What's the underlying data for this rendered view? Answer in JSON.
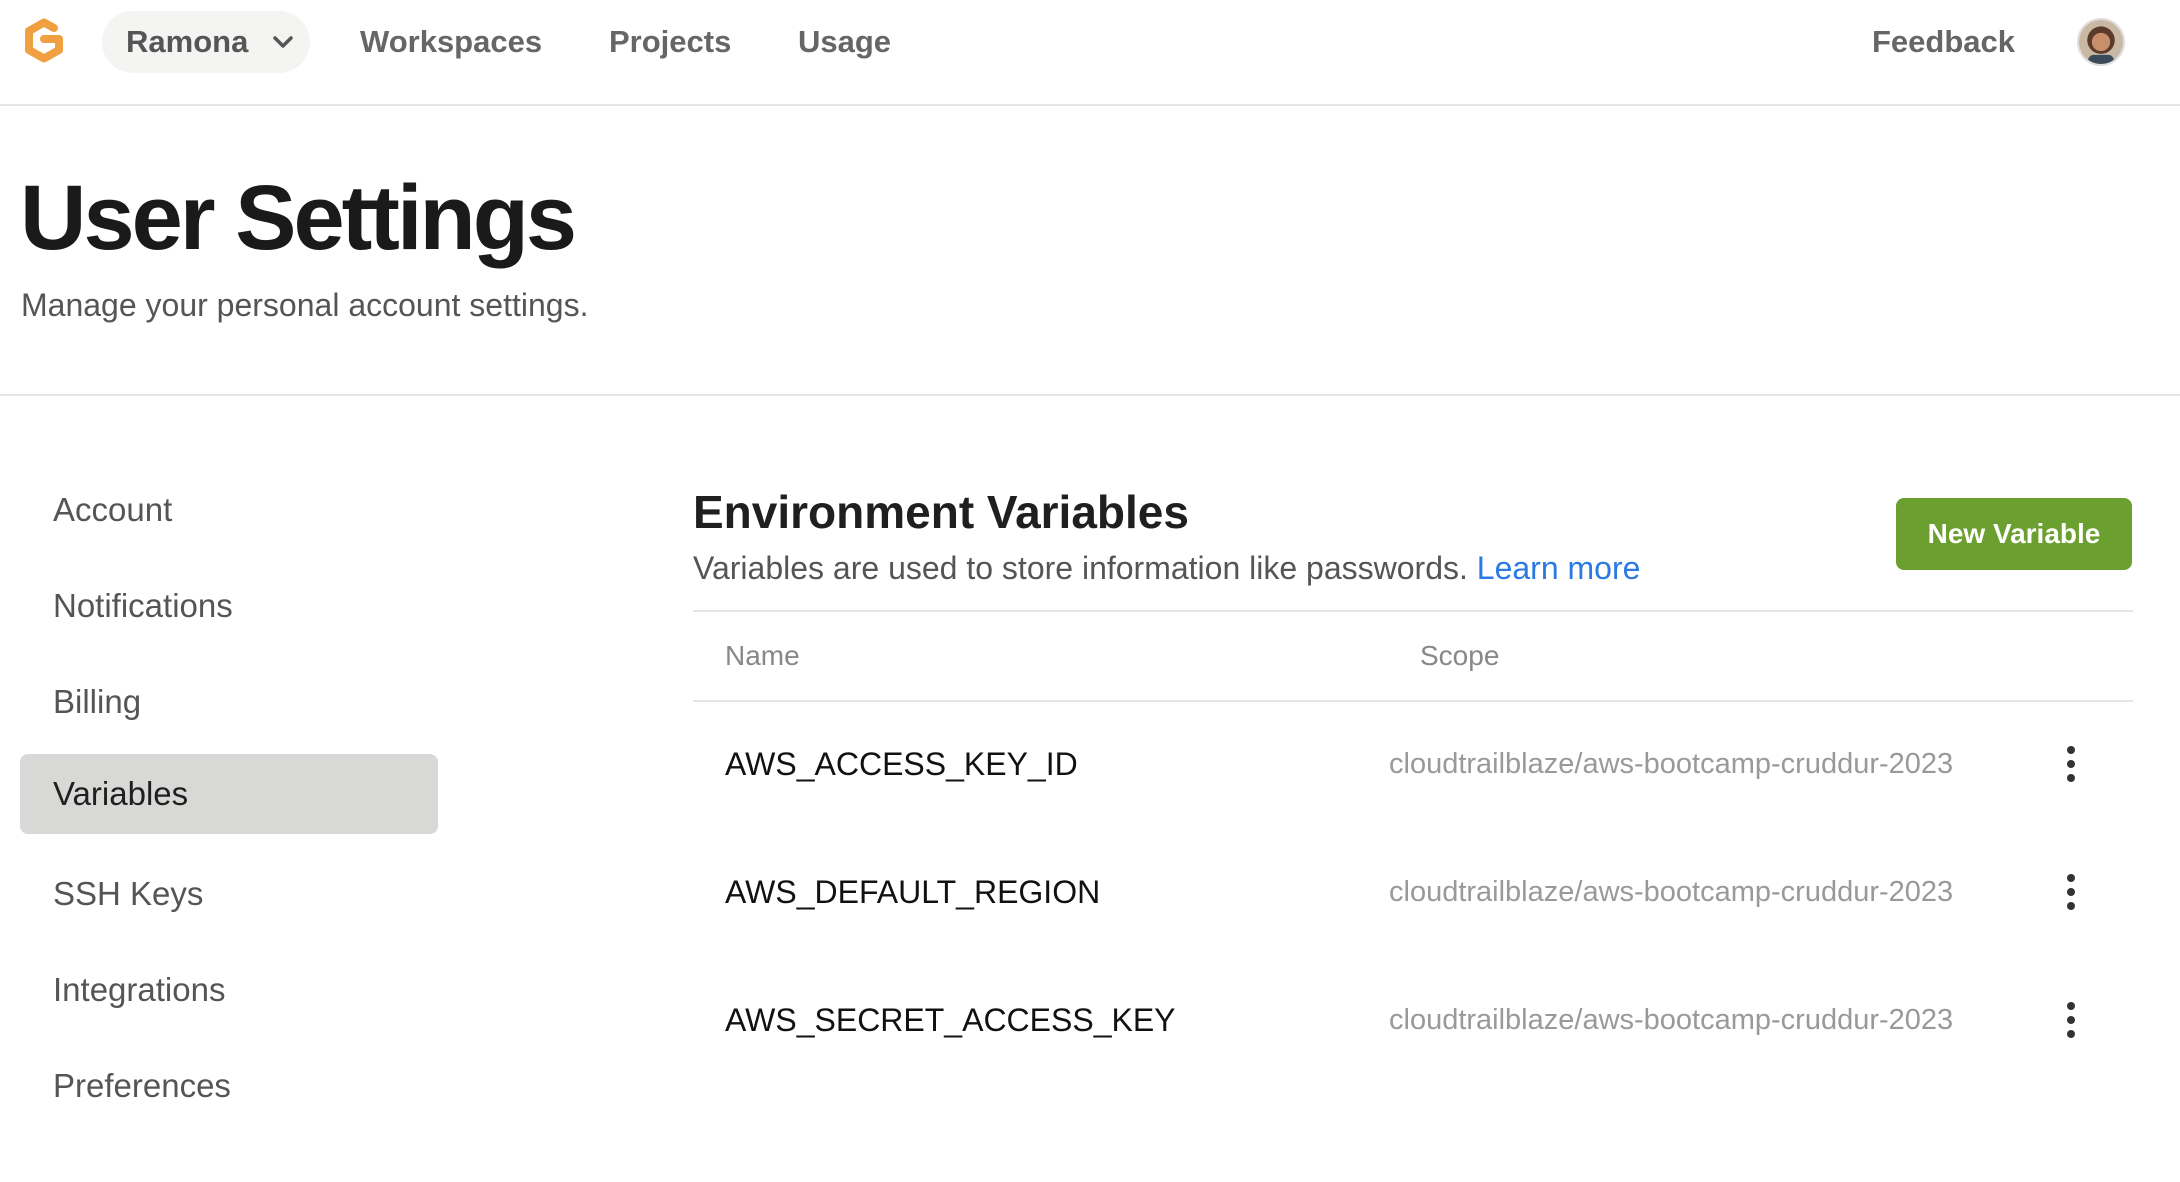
{
  "nav": {
    "workspace": "Ramona",
    "links": [
      "Workspaces",
      "Projects",
      "Usage"
    ],
    "feedback": "Feedback",
    "logo_icon": "gitpod-logo-icon",
    "avatar_icon": "user-avatar"
  },
  "header": {
    "title": "User Settings",
    "subtitle": "Manage your personal account settings."
  },
  "sidebar": {
    "items": [
      {
        "label": "Account",
        "active": false
      },
      {
        "label": "Notifications",
        "active": false
      },
      {
        "label": "Billing",
        "active": false
      },
      {
        "label": "Variables",
        "active": true
      },
      {
        "label": "SSH Keys",
        "active": false
      },
      {
        "label": "Integrations",
        "active": false
      },
      {
        "label": "Preferences",
        "active": false
      }
    ]
  },
  "main": {
    "title": "Environment Variables",
    "description": "Variables are used to store information like passwords.",
    "learn_more": "Learn more",
    "new_button": "New Variable",
    "columns": [
      "Name",
      "Scope"
    ],
    "rows": [
      {
        "name": "AWS_ACCESS_KEY_ID",
        "scope": "cloudtrailblaze/aws-bootcamp-cruddur-2023"
      },
      {
        "name": "AWS_DEFAULT_REGION",
        "scope": "cloudtrailblaze/aws-bootcamp-cruddur-2023"
      },
      {
        "name": "AWS_SECRET_ACCESS_KEY",
        "scope": "cloudtrailblaze/aws-bootcamp-cruddur-2023"
      }
    ]
  },
  "colors": {
    "accent_green": "#6b9f2f",
    "link_blue": "#2a7ae2",
    "active_sidebar": "#d8d8d6",
    "logo_orange": "#f0a040"
  }
}
